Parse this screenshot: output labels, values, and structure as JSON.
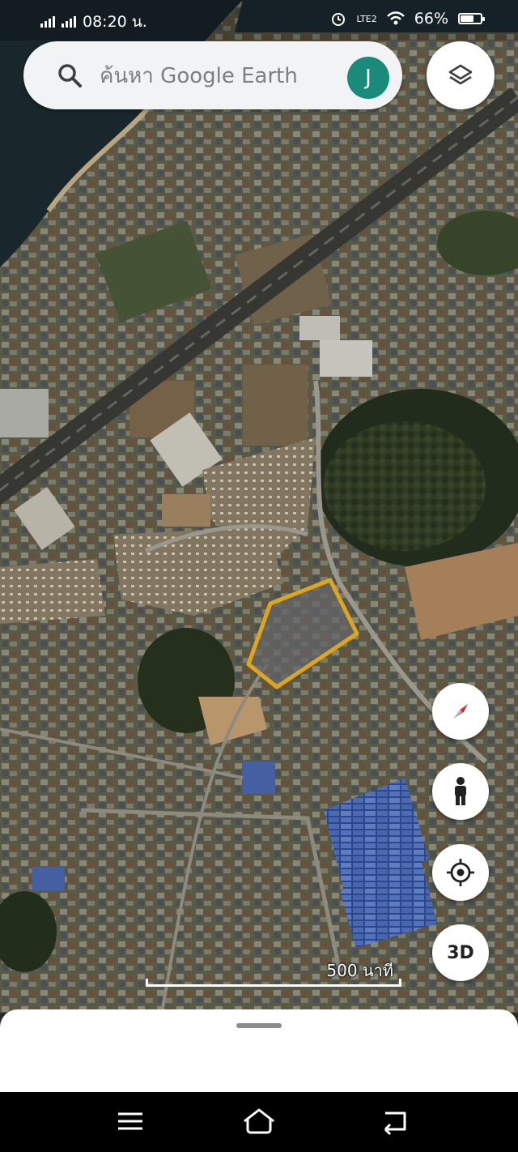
{
  "status_bar": {
    "carrier_signal": "signal-icon",
    "time": "08:20 น.",
    "network": "LTE2",
    "battery_percent": "66%",
    "battery_level": 0.66
  },
  "search": {
    "placeholder": "ค้นหา Google Earth",
    "value": "",
    "avatar_initial": "J"
  },
  "controls": {
    "layers": "layers-icon",
    "compass": "compass-icon",
    "street_view": "pegman-icon",
    "my_location": "my-location-icon",
    "view_3d_label": "3D"
  },
  "map": {
    "scale_label": "500 นาที",
    "highlight_color": "#f0b323"
  },
  "nav_bar": {
    "menu": "menu-icon",
    "home": "home-icon",
    "back": "back-icon"
  }
}
